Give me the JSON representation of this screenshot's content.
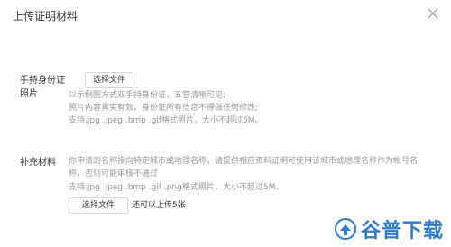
{
  "dialog": {
    "title": "上传证明材料"
  },
  "id_photo": {
    "label_line1": "手持身份证",
    "label_line2": "照片",
    "button_label": "选择文件",
    "hints": [
      "以示例图方式双手持身份证，五官清晰可见;",
      "照片内容真实有效，身份证所有信息不得做任何修改;",
      "支持.jpg .jpeg .bmp .gif格式照片，大小不超过5M。"
    ]
  },
  "supplement": {
    "label": "补充材料",
    "description": "你申请的名称指向特定城市或地理名称，请提供相应资料证明可使用该城市或地理名称作为帐号名称，否则可能审核不通过",
    "formats": "支持.jpg .jpeg .bmp .gif .png格式照片，大小不超过5M。",
    "button_label": "选择文件",
    "upload_limit": "还可以上传5张"
  },
  "watermark": {
    "text": "谷普下载"
  },
  "colors": {
    "hint": "#999999",
    "border": "#d9d9d9",
    "watermark": "#2e7bd6"
  }
}
